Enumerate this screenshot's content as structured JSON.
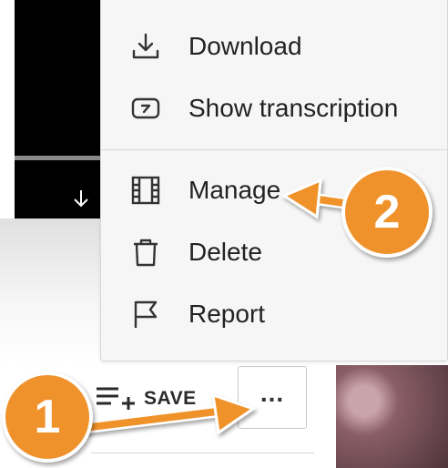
{
  "menu": {
    "items": [
      {
        "label": "Download",
        "icon": "download-icon"
      },
      {
        "label": "Show transcription",
        "icon": "transcript-icon"
      },
      {
        "label": "Manage",
        "icon": "film-icon"
      },
      {
        "label": "Delete",
        "icon": "trash-icon"
      },
      {
        "label": "Report",
        "icon": "flag-icon"
      }
    ]
  },
  "actions": {
    "save_label": "SAVE",
    "more_label": "...",
    "save_icon": "playlist-add-icon"
  },
  "annotations": {
    "step1": "1",
    "step2": "2",
    "color": "#f0922c"
  }
}
